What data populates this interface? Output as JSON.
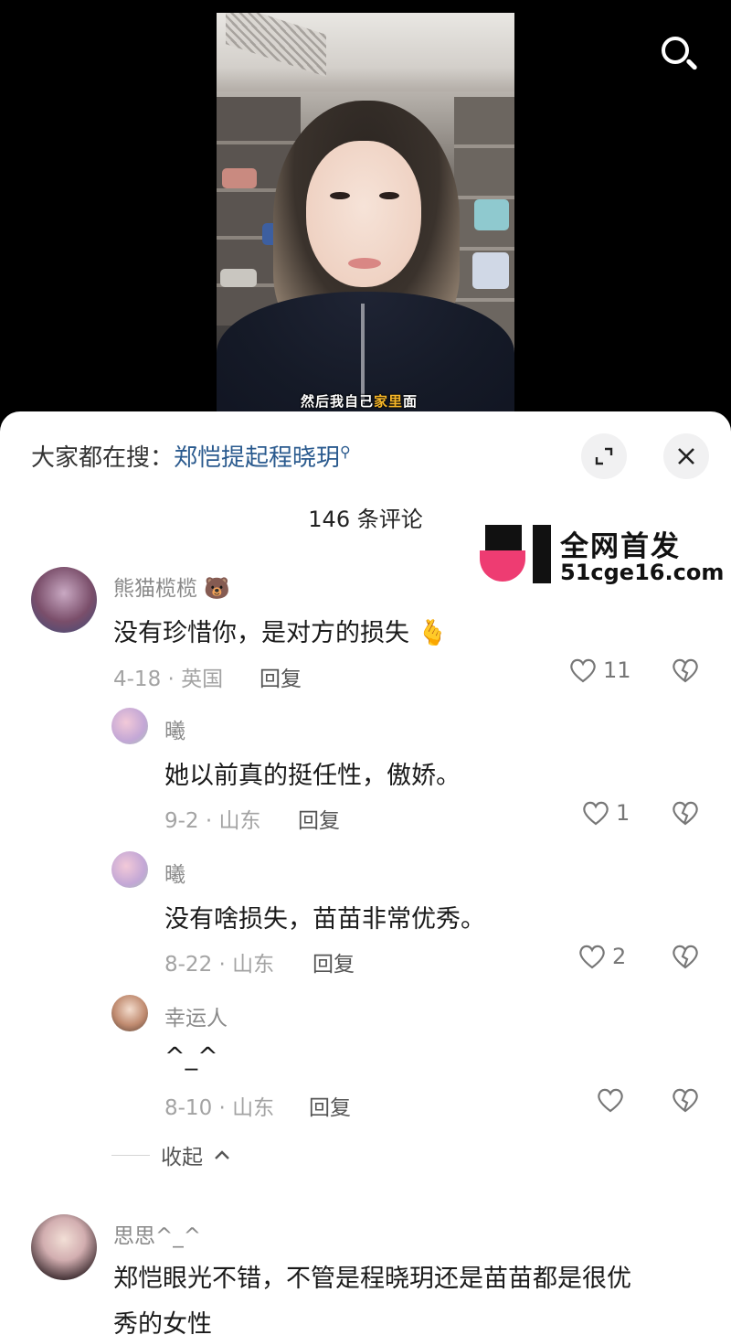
{
  "video": {
    "subtitle_prefix": "然后我自己",
    "subtitle_highlight": "家里",
    "subtitle_suffix": "面"
  },
  "sheet": {
    "search_prefix": "大家都在搜：",
    "search_keyword": "郑恺提起程晓玥",
    "comment_count": "146 条评论"
  },
  "watermark": {
    "line1": "全网首发",
    "line2": "51cge16.com"
  },
  "comments": [
    {
      "username": "熊猫榄榄 🐻",
      "content": "没有珍惜你，是对方的损失 🫰",
      "meta": "4-18 · 英国",
      "reply_label": "回复",
      "likes": "11"
    }
  ],
  "replies": [
    {
      "username": "曦",
      "content": "她以前真的挺任性，傲娇。",
      "meta": "9-2 · 山东",
      "reply_label": "回复",
      "likes": "1"
    },
    {
      "username": "曦",
      "content": "没有啥损失，苗苗非常优秀。",
      "meta": "8-22 · 山东",
      "reply_label": "回复",
      "likes": "2"
    },
    {
      "username": "幸运人",
      "content": "^_^",
      "meta": "8-10 · 山东",
      "reply_label": "回复",
      "likes": ""
    }
  ],
  "collapse_label": "收起",
  "comment2": {
    "username": "思思^_^",
    "content_line1": "郑恺眼光不错，不管是程晓玥还是苗苗都是很优",
    "content_line2": "秀的女性"
  },
  "icons": {
    "search": "search-icon",
    "expand": "expand-icon",
    "close": "close-icon",
    "like": "heart-icon",
    "dislike": "broken-heart-icon",
    "collapse": "chevron-up-icon"
  }
}
